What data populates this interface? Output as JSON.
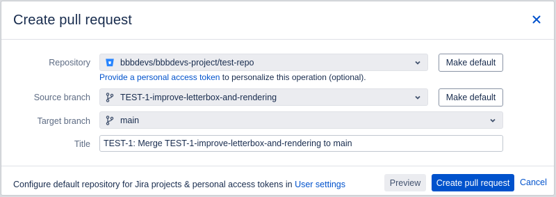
{
  "dialog": {
    "title": "Create pull request",
    "close_icon": "close-icon"
  },
  "form": {
    "repository": {
      "label": "Repository",
      "value": "bbbdevs/bbbdevs-project/test-repo",
      "icon": "bitbucket-icon",
      "make_default_label": "Make default",
      "hint_link": "Provide a personal access token",
      "hint_text": " to personalize this operation (optional)."
    },
    "source_branch": {
      "label": "Source branch",
      "value": "TEST-1-improve-letterbox-and-rendering",
      "icon": "branch-icon",
      "make_default_label": "Make default"
    },
    "target_branch": {
      "label": "Target branch",
      "value": "main",
      "icon": "branch-icon"
    },
    "title": {
      "label": "Title",
      "value": "TEST-1: Merge TEST-1-improve-letterbox-and-rendering to main"
    }
  },
  "footer": {
    "text": "Configure default repository for Jira projects & personal access tokens in ",
    "link": "User settings",
    "preview_label": "Preview",
    "create_label": "Create pull request",
    "cancel_label": "Cancel"
  },
  "colors": {
    "primary": "#0052cc",
    "text": "#172b4d",
    "label": "#5e6c84"
  }
}
